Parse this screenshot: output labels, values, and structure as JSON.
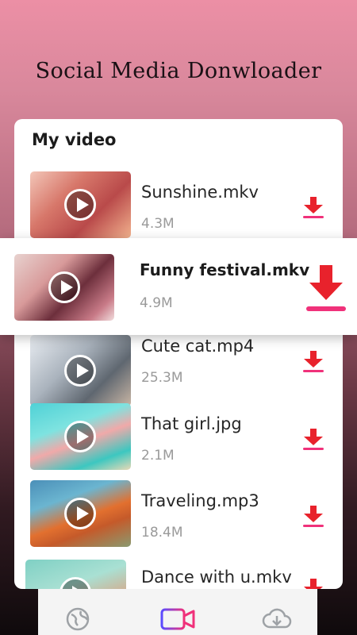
{
  "header": {
    "title": "Social Media Donwloader"
  },
  "card": {
    "title": "My video"
  },
  "videos": [
    {
      "name": "Sunshine.mkv",
      "size": "4.3M",
      "icon": "play-icon"
    },
    {
      "name": "Funny festival.mkv",
      "size": "4.9M",
      "icon": "play-icon"
    },
    {
      "name": "Cute cat.mp4",
      "size": "25.3M",
      "icon": "play-icon"
    },
    {
      "name": "That girl.jpg",
      "size": "2.1M",
      "icon": "play-icon"
    },
    {
      "name": "Traveling.mp3",
      "size": "18.4M",
      "icon": "play-icon"
    },
    {
      "name": "Dance with u.mkv",
      "size": "",
      "icon": "play-icon"
    }
  ],
  "nav": [
    {
      "icon": "globe-icon"
    },
    {
      "icon": "video-camera-icon"
    },
    {
      "icon": "cloud-download-icon"
    }
  ],
  "colors": {
    "accent_red": "#e8222c",
    "accent_pink": "#f0317a",
    "accent_blue": "#5a4bff"
  }
}
